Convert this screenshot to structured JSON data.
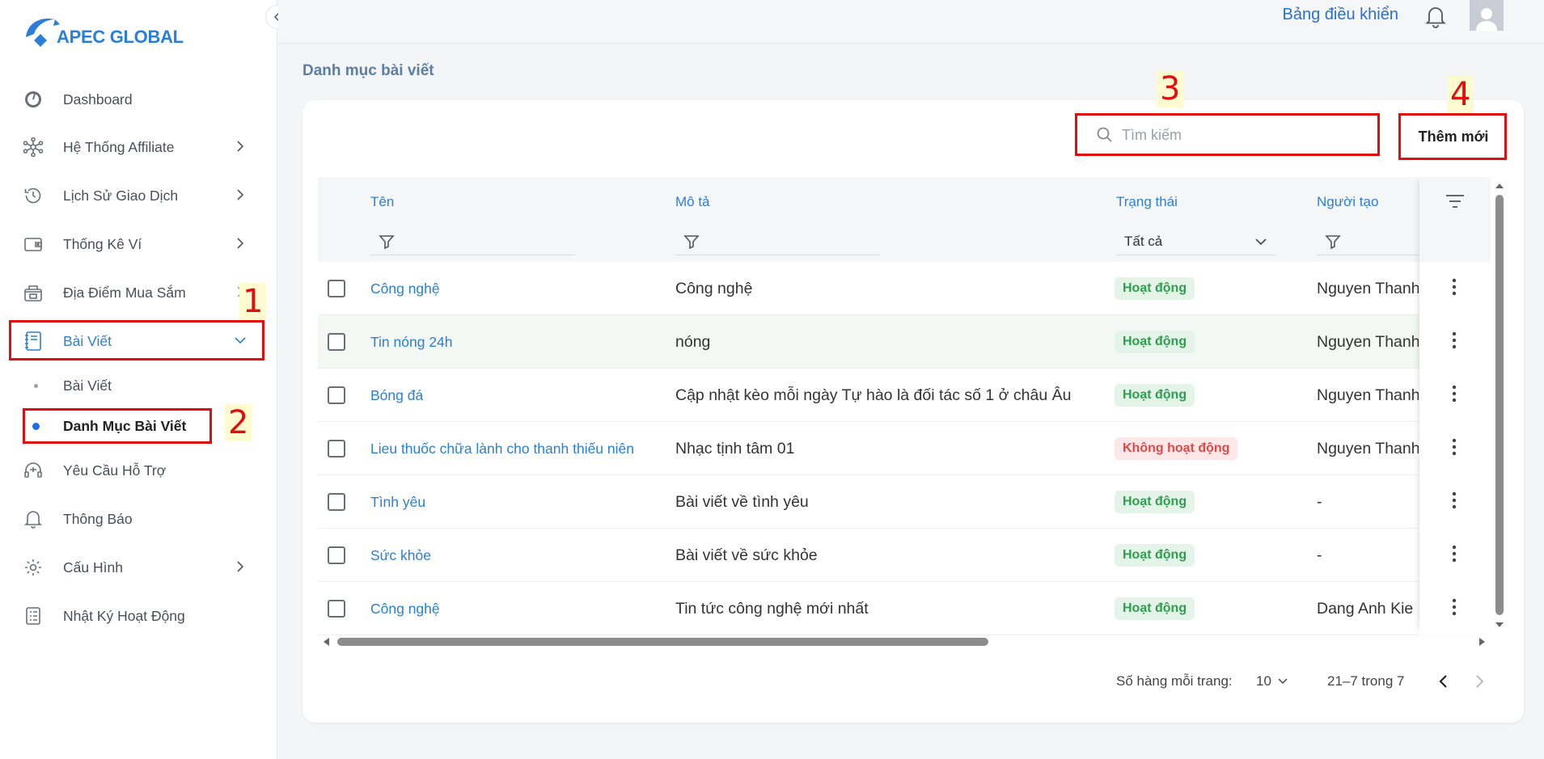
{
  "brand": {
    "name": "APEC GLOBAL",
    "color": "#2b7fd6"
  },
  "sidebar": {
    "items": [
      {
        "label": "Dashboard",
        "icon": "speedometer-icon"
      },
      {
        "label": "Hệ Thống Affiliate",
        "icon": "network-icon"
      },
      {
        "label": "Lịch Sử Giao Dịch",
        "icon": "clock-history-icon"
      },
      {
        "label": "Thống Kê Ví",
        "icon": "wallet-icon"
      },
      {
        "label": "Địa Điểm Mua Sắm",
        "icon": "store-icon"
      },
      {
        "label": "Bài Viết",
        "icon": "article-icon"
      },
      {
        "label": "Yêu Cầu Hỗ Trợ",
        "icon": "headset-icon"
      },
      {
        "label": "Thông Báo",
        "icon": "bell-icon"
      },
      {
        "label": "Cấu Hình",
        "icon": "gear-icon"
      },
      {
        "label": "Nhật Ký Hoạt Động",
        "icon": "log-icon"
      }
    ],
    "subitems": [
      {
        "label": "Bài Viết"
      },
      {
        "label": "Danh Mục Bài Viết"
      }
    ]
  },
  "topbar": {
    "dashboard_link": "Bảng điều khiển"
  },
  "page": {
    "title": "Danh mục bài viết"
  },
  "toolbar": {
    "search_placeholder": "Tìm kiếm",
    "add_label": "Thêm mới"
  },
  "table": {
    "columns": [
      "Tên",
      "Mô tả",
      "Trạng thái",
      "Người tạo"
    ],
    "status_filter": "Tất cả",
    "rows": [
      {
        "name": "Công nghệ",
        "desc": "Công nghệ",
        "status": "Hoạt động",
        "user": "Nguyen Thanh"
      },
      {
        "name": "Tin nóng 24h",
        "desc": "nóng",
        "status": "Hoạt động",
        "user": "Nguyen Thanh"
      },
      {
        "name": "Bóng đá",
        "desc": "Cập nhật kèo mỗi ngày Tự hào là đối tác số 1 ở châu Âu",
        "status": "Hoạt động",
        "user": "Nguyen Thanh"
      },
      {
        "name": "Lieu thuốc chữa lành cho thanh thiếu niên",
        "desc": "Nhạc tịnh tâm 01",
        "status": "Không hoạt động",
        "user": "Nguyen Thanh"
      },
      {
        "name": "Tình yêu",
        "desc": "Bài viết về tình yêu",
        "status": "Hoạt động",
        "user": "-"
      },
      {
        "name": "Sức khỏe",
        "desc": "Bài viết về sức khỏe",
        "status": "Hoạt động",
        "user": "-"
      },
      {
        "name": "Công nghệ",
        "desc": "Tin tức công nghệ mới nhất",
        "status": "Hoạt động",
        "user": "Dang Anh Kie"
      }
    ]
  },
  "pagination": {
    "rows_per_page_label": "Số hàng mỗi trang:",
    "rows_per_page": "10",
    "range": "21–7 trong 7"
  },
  "annotations": [
    "1",
    "2",
    "3",
    "4"
  ]
}
